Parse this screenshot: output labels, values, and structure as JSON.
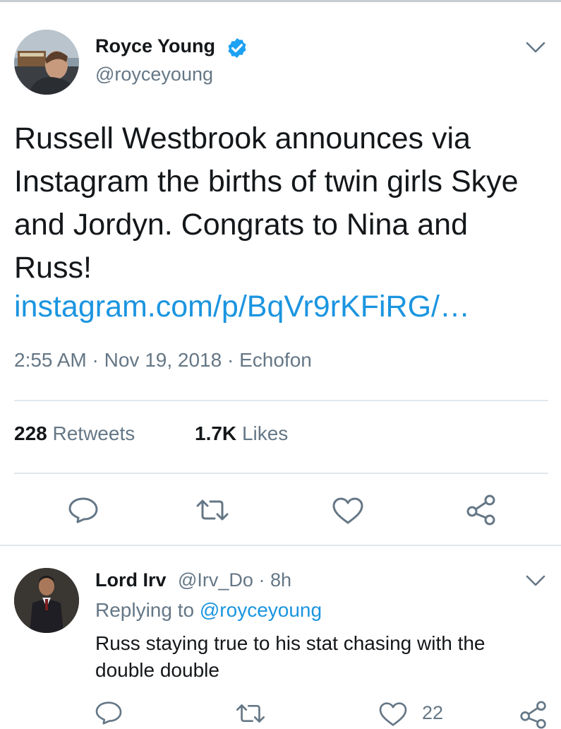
{
  "main_tweet": {
    "author_name": "Royce Young",
    "author_handle": "@royceyoung",
    "text": "Russell Westbrook announces via Instagram the births of twin girls Skye and Jordyn. Congrats to Nina and Russ!",
    "link": "instagram.com/p/BqVr9rKFiRG/…",
    "time": "2:55 AM",
    "date": "Nov 19, 2018",
    "source": "Echofon",
    "separator": "·",
    "retweets_count": "228",
    "retweets_label": "Retweets",
    "likes_count": "1.7K",
    "likes_label": "Likes"
  },
  "reply": {
    "author_name": "Lord Irv",
    "author_handle": "@Irv_Do",
    "time_ago": "8h",
    "separator": "·",
    "replying_prefix": "Replying to",
    "replying_to": "@royceyoung",
    "text": "Russ staying true to his stat chasing with the double double",
    "like_count": "22"
  },
  "colors": {
    "link": "#1b95e0",
    "secondary_text": "#657786",
    "verified_badge": "#1da1f2",
    "divider": "#e1e8ed"
  },
  "icons": [
    "verified-badge-icon",
    "chevron-down-icon",
    "reply-icon",
    "retweet-icon",
    "like-icon",
    "share-icon"
  ]
}
